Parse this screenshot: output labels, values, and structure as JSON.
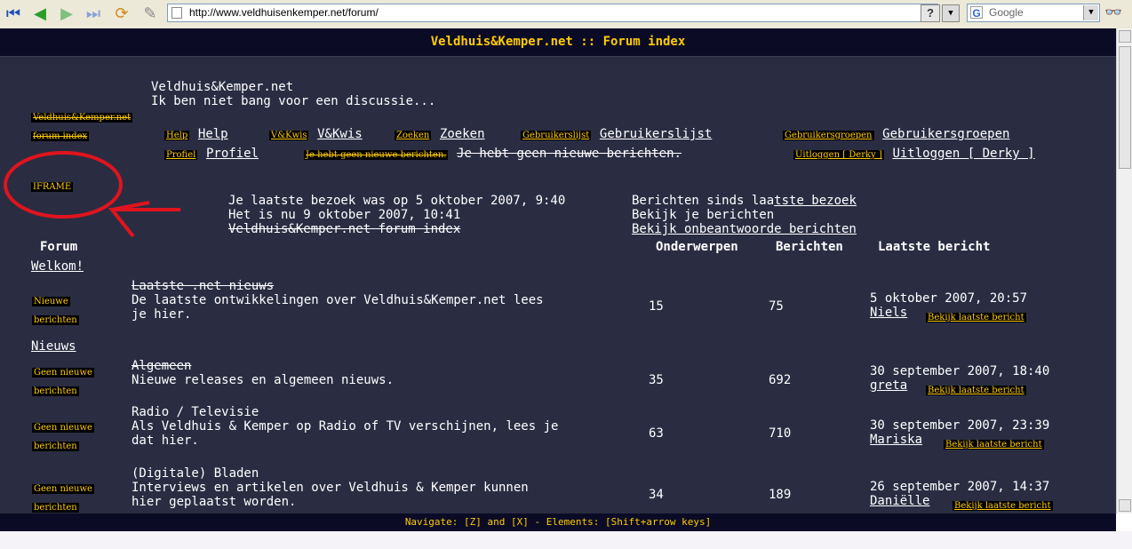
{
  "browser": {
    "url": "http://www.veldhuisenkemper.net/forum/",
    "search_placeholder": "Google",
    "help_label": "?"
  },
  "page": {
    "title": "Veldhuis&Kemper.net :: Forum index",
    "site_name": "Veldhuis&Kemper.net",
    "tagline": "Ik ben niet bang voor een discussie...",
    "logo_alt_1": "Veldhuis&Kemper.net",
    "logo_alt_2": "forum index",
    "iframe_label": "IFRAME",
    "nav": [
      {
        "img": "Help",
        "label": "Help"
      },
      {
        "img": "V&Kwis",
        "label": "V&Kwis"
      },
      {
        "img": "Zoeken",
        "label": "Zoeken"
      },
      {
        "img": "Gebruikerslijst",
        "label": "Gebruikerslijst"
      },
      {
        "img": "Gebruikersgroepen",
        "label": "Gebruikersgroepen"
      }
    ],
    "nav2": [
      {
        "img": "Profiel",
        "label": "Profiel"
      },
      {
        "img": "Je hebt geen nieuwe berichten.",
        "label": "Je hebt geen nieuwe berichten."
      },
      {
        "img": "Uitloggen [ Derky ]",
        "label": "Uitloggen [ Derky ]"
      }
    ],
    "last_visit": "Je laatste bezoek was op 5 oktober 2007, 9:40",
    "now": "Het is nu 9 oktober 2007, 10:41",
    "forum_index_link": "Veldhuis&Kemper.net forum index",
    "since_last_prefix": "Berichten sinds laa",
    "since_last_link": "tste bezoek",
    "view_posts": "Bekijk je berichten",
    "view_unanswered": "Bekijk onbeantwoorde berichten",
    "headers": {
      "forum": "Forum",
      "topics": "Onderwerpen",
      "posts": "Berichten",
      "last_post": "Laatste bericht"
    },
    "categories": [
      {
        "name": "Welkom!",
        "forums": [
          {
            "status_1": "Nieuwe",
            "status_2": "berichten",
            "title": "Laatste .net nieuws",
            "desc_1": "De laatste ontwikkelingen over Veldhuis&Kemper.net lees",
            "desc_2": "je hier.",
            "topics": "15",
            "posts": "75",
            "date": "5 oktober 2007, 20:57",
            "user": "Niels",
            "view_last": "Bekijk laatste bericht"
          }
        ]
      },
      {
        "name": "Nieuws",
        "forums": [
          {
            "status_1": "Geen nieuwe",
            "status_2": "berichten",
            "title": "Algemeen",
            "desc_1": "Nieuwe releases en algemeen nieuws.",
            "desc_2": "",
            "topics": "35",
            "posts": "692",
            "date": "30 september 2007, 18:40",
            "user": "greta",
            "view_last": "Bekijk laatste bericht"
          },
          {
            "status_1": "Geen nieuwe",
            "status_2": "berichten",
            "title": "Radio / Televisie",
            "desc_1": "Als Veldhuis & Kemper op Radio of TV verschijnen, lees je",
            "desc_2": "dat hier.",
            "topics": "63",
            "posts": "710",
            "date": "30 september 2007, 23:39",
            "user": "Mariska",
            "view_last": "Bekijk laatste bericht"
          },
          {
            "status_1": "Geen nieuwe",
            "status_2": "berichten",
            "title": "(Digitale) Bladen",
            "desc_1": "Interviews en artikelen over Veldhuis & Kemper kunnen",
            "desc_2": "hier geplaatst worden.",
            "topics": "34",
            "posts": "189",
            "date": "26 september 2007, 14:37",
            "user": "Daniëlle",
            "view_last": "Bekijk laatste bericht"
          }
        ]
      }
    ],
    "status_bar": "Navigate: [Z] and [X] - Elements: [Shift+arrow keys]"
  },
  "colors": {
    "background": "#2a2d42",
    "titlebar": "#0b0b26",
    "accent": "#ffcc00",
    "annotation": "#e0141e"
  }
}
